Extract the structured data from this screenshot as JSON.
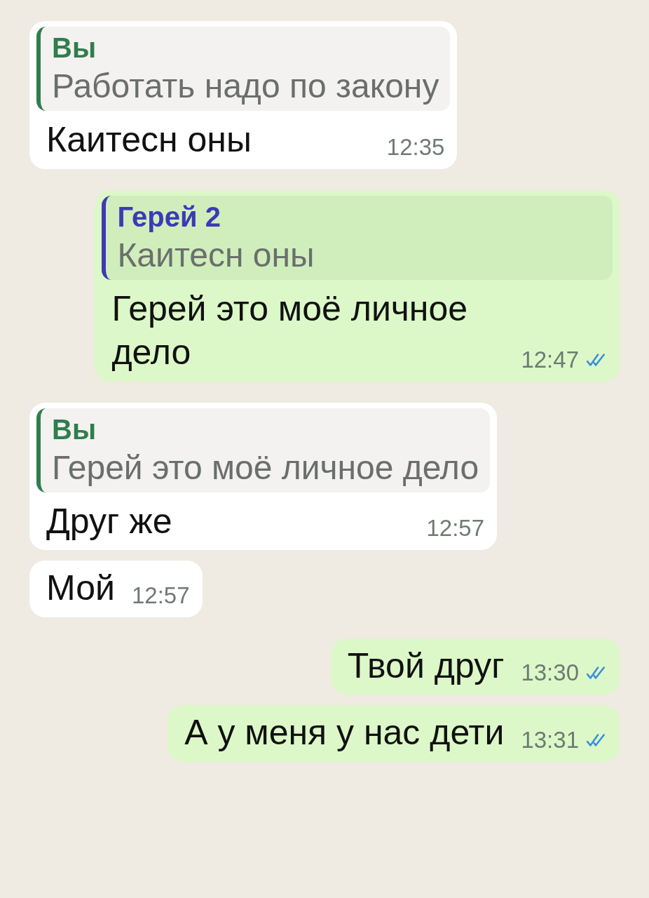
{
  "messages": [
    {
      "outgoing": false,
      "quote": {
        "author": "Вы",
        "text": "Работать надо по закону",
        "color": "#2f7d4e"
      },
      "text": "Каитесн оны",
      "time": "12:35"
    },
    {
      "outgoing": true,
      "quote": {
        "author": "Герей 2",
        "text": "Каитесн оны",
        "color": "#3d3ab4"
      },
      "text": "Герей это моё личное дело",
      "time": "12:47",
      "read": true
    },
    {
      "outgoing": false,
      "quote": {
        "author": "Вы",
        "text": "Герей это моё личное дело",
        "color": "#2f7d4e"
      },
      "text": "Друг же",
      "time": "12:57"
    },
    {
      "outgoing": false,
      "text": "Мой",
      "time": "12:57"
    },
    {
      "outgoing": true,
      "text": "Твой друг",
      "time": "13:30",
      "read": true
    },
    {
      "outgoing": true,
      "text": "А у меня у нас дети",
      "time": "13:31",
      "read": true
    }
  ]
}
